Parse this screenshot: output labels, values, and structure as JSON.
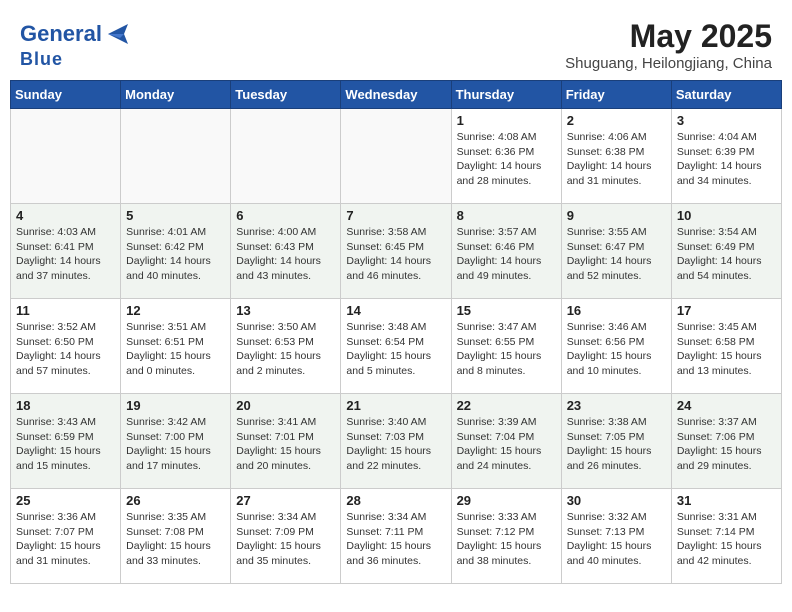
{
  "logo": {
    "line1": "General",
    "line2": "Blue"
  },
  "title": "May 2025",
  "location": "Shuguang, Heilongjiang, China",
  "days_header": [
    "Sunday",
    "Monday",
    "Tuesday",
    "Wednesday",
    "Thursday",
    "Friday",
    "Saturday"
  ],
  "weeks": [
    {
      "shaded": false,
      "days": [
        {
          "num": "",
          "info": ""
        },
        {
          "num": "",
          "info": ""
        },
        {
          "num": "",
          "info": ""
        },
        {
          "num": "",
          "info": ""
        },
        {
          "num": "1",
          "info": "Sunrise: 4:08 AM\nSunset: 6:36 PM\nDaylight: 14 hours\nand 28 minutes."
        },
        {
          "num": "2",
          "info": "Sunrise: 4:06 AM\nSunset: 6:38 PM\nDaylight: 14 hours\nand 31 minutes."
        },
        {
          "num": "3",
          "info": "Sunrise: 4:04 AM\nSunset: 6:39 PM\nDaylight: 14 hours\nand 34 minutes."
        }
      ]
    },
    {
      "shaded": true,
      "days": [
        {
          "num": "4",
          "info": "Sunrise: 4:03 AM\nSunset: 6:41 PM\nDaylight: 14 hours\nand 37 minutes."
        },
        {
          "num": "5",
          "info": "Sunrise: 4:01 AM\nSunset: 6:42 PM\nDaylight: 14 hours\nand 40 minutes."
        },
        {
          "num": "6",
          "info": "Sunrise: 4:00 AM\nSunset: 6:43 PM\nDaylight: 14 hours\nand 43 minutes."
        },
        {
          "num": "7",
          "info": "Sunrise: 3:58 AM\nSunset: 6:45 PM\nDaylight: 14 hours\nand 46 minutes."
        },
        {
          "num": "8",
          "info": "Sunrise: 3:57 AM\nSunset: 6:46 PM\nDaylight: 14 hours\nand 49 minutes."
        },
        {
          "num": "9",
          "info": "Sunrise: 3:55 AM\nSunset: 6:47 PM\nDaylight: 14 hours\nand 52 minutes."
        },
        {
          "num": "10",
          "info": "Sunrise: 3:54 AM\nSunset: 6:49 PM\nDaylight: 14 hours\nand 54 minutes."
        }
      ]
    },
    {
      "shaded": false,
      "days": [
        {
          "num": "11",
          "info": "Sunrise: 3:52 AM\nSunset: 6:50 PM\nDaylight: 14 hours\nand 57 minutes."
        },
        {
          "num": "12",
          "info": "Sunrise: 3:51 AM\nSunset: 6:51 PM\nDaylight: 15 hours\nand 0 minutes."
        },
        {
          "num": "13",
          "info": "Sunrise: 3:50 AM\nSunset: 6:53 PM\nDaylight: 15 hours\nand 2 minutes."
        },
        {
          "num": "14",
          "info": "Sunrise: 3:48 AM\nSunset: 6:54 PM\nDaylight: 15 hours\nand 5 minutes."
        },
        {
          "num": "15",
          "info": "Sunrise: 3:47 AM\nSunset: 6:55 PM\nDaylight: 15 hours\nand 8 minutes."
        },
        {
          "num": "16",
          "info": "Sunrise: 3:46 AM\nSunset: 6:56 PM\nDaylight: 15 hours\nand 10 minutes."
        },
        {
          "num": "17",
          "info": "Sunrise: 3:45 AM\nSunset: 6:58 PM\nDaylight: 15 hours\nand 13 minutes."
        }
      ]
    },
    {
      "shaded": true,
      "days": [
        {
          "num": "18",
          "info": "Sunrise: 3:43 AM\nSunset: 6:59 PM\nDaylight: 15 hours\nand 15 minutes."
        },
        {
          "num": "19",
          "info": "Sunrise: 3:42 AM\nSunset: 7:00 PM\nDaylight: 15 hours\nand 17 minutes."
        },
        {
          "num": "20",
          "info": "Sunrise: 3:41 AM\nSunset: 7:01 PM\nDaylight: 15 hours\nand 20 minutes."
        },
        {
          "num": "21",
          "info": "Sunrise: 3:40 AM\nSunset: 7:03 PM\nDaylight: 15 hours\nand 22 minutes."
        },
        {
          "num": "22",
          "info": "Sunrise: 3:39 AM\nSunset: 7:04 PM\nDaylight: 15 hours\nand 24 minutes."
        },
        {
          "num": "23",
          "info": "Sunrise: 3:38 AM\nSunset: 7:05 PM\nDaylight: 15 hours\nand 26 minutes."
        },
        {
          "num": "24",
          "info": "Sunrise: 3:37 AM\nSunset: 7:06 PM\nDaylight: 15 hours\nand 29 minutes."
        }
      ]
    },
    {
      "shaded": false,
      "days": [
        {
          "num": "25",
          "info": "Sunrise: 3:36 AM\nSunset: 7:07 PM\nDaylight: 15 hours\nand 31 minutes."
        },
        {
          "num": "26",
          "info": "Sunrise: 3:35 AM\nSunset: 7:08 PM\nDaylight: 15 hours\nand 33 minutes."
        },
        {
          "num": "27",
          "info": "Sunrise: 3:34 AM\nSunset: 7:09 PM\nDaylight: 15 hours\nand 35 minutes."
        },
        {
          "num": "28",
          "info": "Sunrise: 3:34 AM\nSunset: 7:11 PM\nDaylight: 15 hours\nand 36 minutes."
        },
        {
          "num": "29",
          "info": "Sunrise: 3:33 AM\nSunset: 7:12 PM\nDaylight: 15 hours\nand 38 minutes."
        },
        {
          "num": "30",
          "info": "Sunrise: 3:32 AM\nSunset: 7:13 PM\nDaylight: 15 hours\nand 40 minutes."
        },
        {
          "num": "31",
          "info": "Sunrise: 3:31 AM\nSunset: 7:14 PM\nDaylight: 15 hours\nand 42 minutes."
        }
      ]
    }
  ]
}
